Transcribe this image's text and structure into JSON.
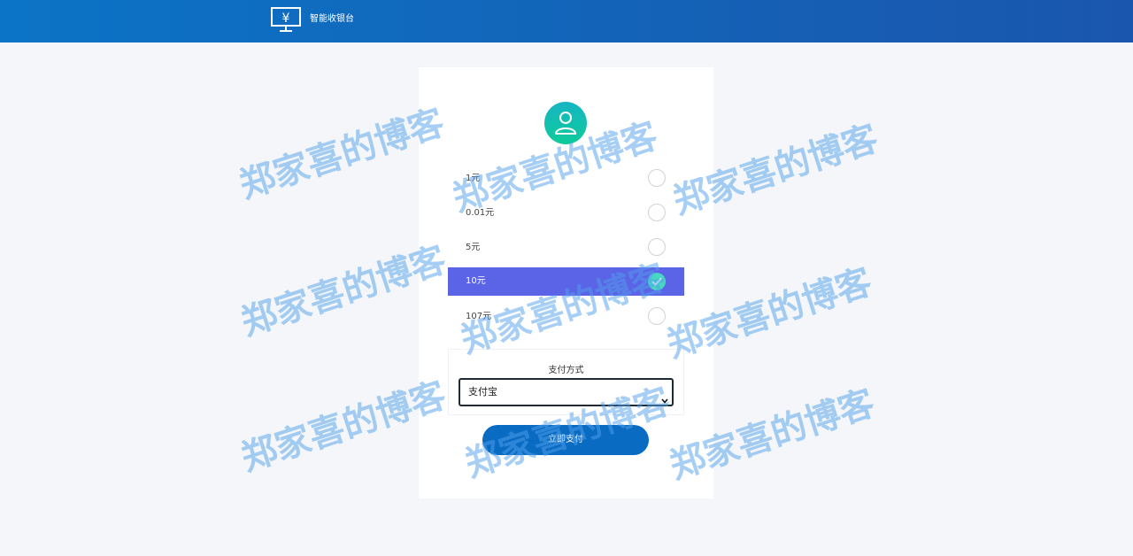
{
  "header": {
    "title": "智能收银台",
    "icon": "cashier-monitor-icon",
    "brand_color": "#0b74c6"
  },
  "card": {
    "avatar_icon": "user-icon",
    "amounts": [
      {
        "label": "1元",
        "selected": false
      },
      {
        "label": "0.01元",
        "selected": false
      },
      {
        "label": "5元",
        "selected": false
      },
      {
        "label": "10元",
        "selected": true
      },
      {
        "label": "107元",
        "selected": false
      }
    ],
    "selected_color": "#5b63e6",
    "check_color": "#48d6c2",
    "payment": {
      "label": "支付方式",
      "selected_value": "支付宝"
    },
    "submit_label": "立即支付",
    "button_color": "#0a6bc2"
  },
  "watermark": {
    "text": "郑家喜的博客"
  }
}
